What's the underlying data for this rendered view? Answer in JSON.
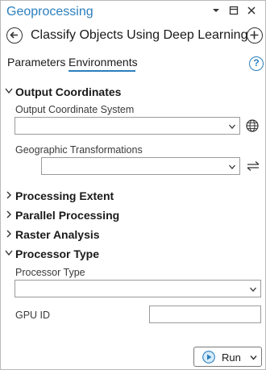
{
  "titlebar": {
    "title": "Geoprocessing",
    "buttons": {
      "menu": "▾",
      "pin": "⊟",
      "close": "✕"
    }
  },
  "tool": {
    "back_icon": "back-arrow-icon",
    "title": "Classify Objects Using Deep Learning",
    "add_icon": "add-icon"
  },
  "tabs": [
    {
      "label": "Parameters",
      "active": false
    },
    {
      "label": "Environments",
      "active": true
    }
  ],
  "help_icon": "?",
  "sections": {
    "output_coordinates": {
      "label": "Output Coordinates",
      "expanded": true,
      "output_cs_label": "Output Coordinate System",
      "output_cs_value": "",
      "geo_transform_label": "Geographic Transformations",
      "geo_transform_value": ""
    },
    "processing_extent": {
      "label": "Processing Extent",
      "expanded": false
    },
    "parallel_processing": {
      "label": "Parallel Processing",
      "expanded": false
    },
    "raster_analysis": {
      "label": "Raster Analysis",
      "expanded": false
    },
    "processor_type": {
      "label": "Processor Type",
      "expanded": true,
      "processor_label": "Processor Type",
      "processor_value": "",
      "gpu_label": "GPU ID",
      "gpu_value": ""
    }
  },
  "footer": {
    "run_label": "Run"
  },
  "colors": {
    "accent": "#2a7fbd",
    "text": "#1a1a1a",
    "border": "#9a9a9a"
  }
}
